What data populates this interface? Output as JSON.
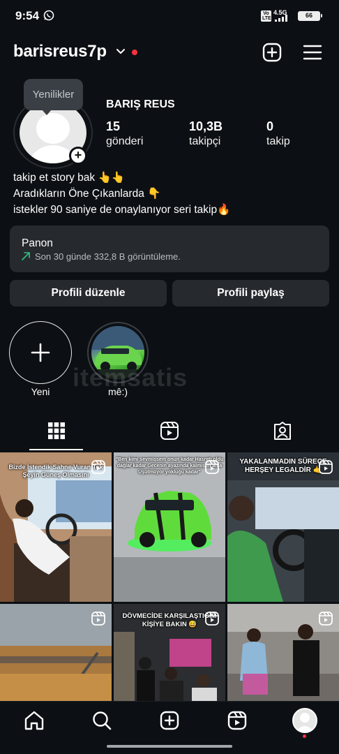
{
  "status_bar": {
    "time": "9:54",
    "volte": "Vo LTE",
    "network": "4.5G",
    "battery": "66",
    "icons": [
      "whatsapp-icon",
      "signal-icon",
      "battery-icon"
    ]
  },
  "header": {
    "username": "barisreus7p",
    "icons": [
      "chevron-down-icon",
      "notification-dot",
      "create-plus-icon",
      "hamburger-menu-icon"
    ]
  },
  "profile": {
    "tooltip": "Yenilikler",
    "display_name": "BARIŞ REUS",
    "stats": [
      {
        "value": "15",
        "label": "gönderi"
      },
      {
        "value": "10,3B",
        "label": "takipçi"
      },
      {
        "value": "0",
        "label": "takip"
      }
    ],
    "bio": [
      "takip et story bak 👆👆",
      "Aradıkların Öne Çıkanlarda  👇",
      "istekler 90 saniye de onaylanıyor seri takip🔥"
    ]
  },
  "dashboard": {
    "title": "Panon",
    "subtitle": "Son 30 günde 332,8 B görüntüleme."
  },
  "buttons": {
    "edit": "Profili düzenle",
    "share": "Profili paylaş"
  },
  "highlights": [
    {
      "label": "Yeni"
    },
    {
      "label": "mê:)"
    }
  ],
  "watermark": "itemsatis",
  "tabs": [
    "grid-icon",
    "reels-icon",
    "tagged-icon"
  ],
  "posts": [
    {
      "caption": "Bizde İstendik Sahne Vuran Tek Şeyin Güneş Olmasını",
      "type": "reel"
    },
    {
      "caption": "\"Ben kimi sevmişsem onun kadar Hasreti oldu dağlar kadar Gecenin ayazında kalmışım ama Üşütmüyor yokluğu kadar\"",
      "type": "reel"
    },
    {
      "caption": "YAKALANMADIN SÜRECE HERŞEY LEGALDİR 🤙",
      "type": "reel"
    },
    {
      "caption": "",
      "type": "reel"
    },
    {
      "caption": "DÖVMECİDE KARŞILAŞTIĞIM KİŞİYE BAKIN 😅",
      "type": "reel"
    },
    {
      "caption": "",
      "type": "reel"
    }
  ],
  "nav": [
    "home-icon",
    "search-icon",
    "create-icon",
    "reels-icon",
    "profile-avatar"
  ],
  "colors": {
    "background": "#0c1014",
    "surface": "#262a2f",
    "accent_red": "#ff3040",
    "trend_green": "#32c47e"
  }
}
